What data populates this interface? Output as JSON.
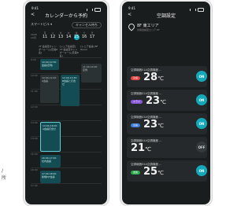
{
  "phone1": {
    "status_time": "9:41",
    "back": "<",
    "title": "カレンダーから予約",
    "toolbar": {
      "left": "スマートビル ▾",
      "right": "キャンセル待ち"
    },
    "year": "2026 10月",
    "days": [
      {
        "w": "月",
        "n": "11"
      },
      {
        "w": "火",
        "n": "12"
      },
      {
        "w": "水",
        "n": "13"
      },
      {
        "w": "木",
        "n": "14"
      },
      {
        "w": "金",
        "n": "15",
        "sel": true
      },
      {
        "w": "土",
        "n": "16"
      },
      {
        "w": "日",
        "n": "17"
      }
    ],
    "columns": [
      "7F 会議室カレンダールーム(定員8名)",
      "[シェア会議室] 7F 会議室カレンダールーム(定員8名)",
      "[シェア会議] 8F Room"
    ],
    "times": [
      "9:00",
      "10:00",
      "11:00",
      "12:00",
      "13:00",
      "14:00",
      "15:00",
      "16:00",
      "17:00"
    ],
    "events": [
      {
        "t": "10:00-10:30 会議(定例)"
      },
      {
        "t": "10:00-12:00 A会議"
      },
      {
        "t": "12:00-13:30 B会議と打合せ"
      },
      {
        "t": "11:00-12:00 定例"
      },
      {
        "t": "14:00-16:00 A会議打合せ"
      },
      {
        "t": "16:00-17:00 社内会議"
      },
      {
        "t": "17:00-18:00 新規PJT会議"
      }
    ]
  },
  "phone2": {
    "status_time": "9:41",
    "back": "<",
    "title": "空調設定",
    "location": "8F 東エリア",
    "location_sub": "共用会議室エリア 8F",
    "units": [
      {
        "name": "空調機器01A空調機器 ...",
        "badge": "冷房",
        "badge_color": "#e04848",
        "temp": "28",
        "unit": "℃",
        "state": "ON"
      },
      {
        "name": "空調機器02A空調機器 ...",
        "badge": "ドライ",
        "badge_color": "#8a58d6",
        "temp": "23",
        "unit": "℃",
        "state": "ON"
      },
      {
        "name": "空調機器03A空調機器 ...",
        "badge": "冷房",
        "badge_color": "#3f7fd8",
        "temp": "23",
        "unit": "℃",
        "state": "ON"
      },
      {
        "name": "空調機器04A空調機器 ...",
        "badge": "",
        "badge_color": "#3a3f42",
        "temp": "21",
        "unit": "℃",
        "state": "OFF"
      },
      {
        "name": "空調機器05A空調機器 ...",
        "badge": "送風",
        "badge_color": "#2aa84a",
        "temp": "25",
        "unit": "℃",
        "state": "ON"
      }
    ]
  },
  "footer_text": "/\n所"
}
